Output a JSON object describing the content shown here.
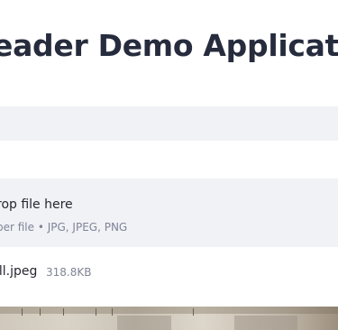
{
  "header": {
    "title": "eader Demo Application"
  },
  "uploader": {
    "drop_text": "rop file here",
    "limit_text": "per file • JPG, JPEG, PNG"
  },
  "uploaded_file": {
    "name": "ill.jpeg",
    "size": "318.8KB"
  }
}
